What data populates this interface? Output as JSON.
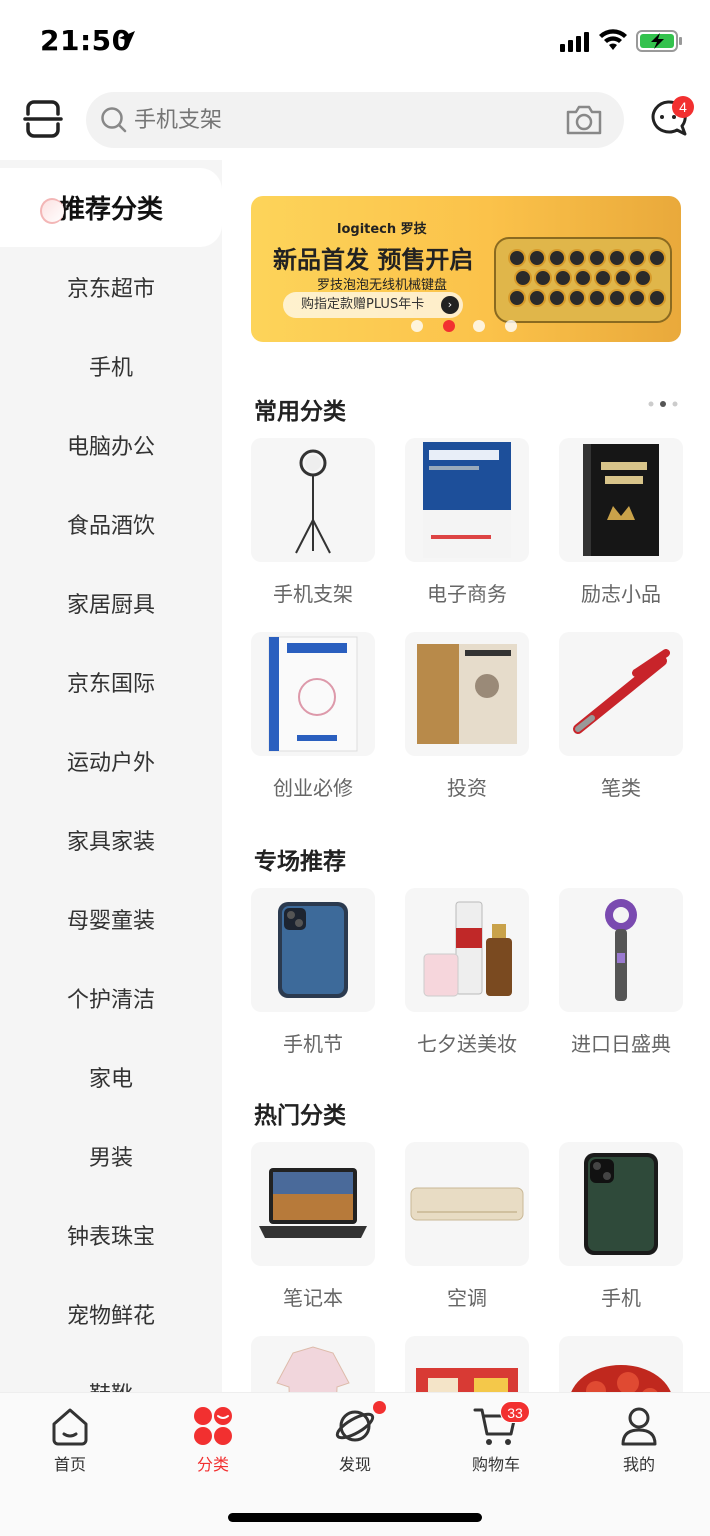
{
  "status": {
    "time": "21:50"
  },
  "search": {
    "placeholder": "手机支架"
  },
  "messages": {
    "badge": "4"
  },
  "sidebar": {
    "items": [
      {
        "label": "推荐分类",
        "active": true
      },
      {
        "label": "京东超市"
      },
      {
        "label": "手机"
      },
      {
        "label": "电脑办公"
      },
      {
        "label": "食品酒饮"
      },
      {
        "label": "家居厨具"
      },
      {
        "label": "京东国际"
      },
      {
        "label": "运动户外"
      },
      {
        "label": "家具家装"
      },
      {
        "label": "母婴童装"
      },
      {
        "label": "个护清洁"
      },
      {
        "label": "家电"
      },
      {
        "label": "男装"
      },
      {
        "label": "钟表珠宝"
      },
      {
        "label": "宠物鲜花"
      },
      {
        "label": "鞋靴"
      }
    ]
  },
  "banner": {
    "brand": "logitech 罗技",
    "title": "新品首发 预售开启",
    "subtitle": "罗技泡泡无线机械键盘",
    "cta": "购指定款赠PLUS年卡",
    "active_dot": 1
  },
  "sections": {
    "common": {
      "title": "常用分类",
      "items": [
        {
          "label": "手机支架",
          "icon": "ring-light-tripod"
        },
        {
          "label": "电子商务",
          "icon": "book-blue"
        },
        {
          "label": "励志小品",
          "icon": "book-black"
        },
        {
          "label": "创业必修",
          "icon": "book-white"
        },
        {
          "label": "投资",
          "icon": "book-brown"
        },
        {
          "label": "笔类",
          "icon": "red-pen"
        }
      ]
    },
    "special": {
      "title": "专场推荐",
      "items": [
        {
          "label": "手机节",
          "icon": "iphone-blue"
        },
        {
          "label": "七夕送美妆",
          "icon": "cosmetics"
        },
        {
          "label": "进口日盛典",
          "icon": "hair-dryer"
        }
      ]
    },
    "hot": {
      "title": "热门分类",
      "items": [
        {
          "label": "笔记本",
          "icon": "laptop"
        },
        {
          "label": "空调",
          "icon": "air-conditioner"
        },
        {
          "label": "手机",
          "icon": "iphone-dark"
        },
        {
          "label": "",
          "icon": "shirt"
        },
        {
          "label": "",
          "icon": "gift-box"
        },
        {
          "label": "",
          "icon": "crayfish"
        }
      ]
    }
  },
  "bottom_nav": {
    "items": [
      {
        "label": "首页",
        "icon": "home-icon"
      },
      {
        "label": "分类",
        "icon": "category-icon",
        "active": true
      },
      {
        "label": "发现",
        "icon": "discover-icon"
      },
      {
        "label": "购物车",
        "icon": "cart-icon"
      },
      {
        "label": "我的",
        "icon": "profile-icon"
      }
    ],
    "cart_badge": "33"
  },
  "colors": {
    "accent": "#f23030",
    "sidebar_bg": "#f5f5f5",
    "banner_yellow": "#fdd45a"
  }
}
